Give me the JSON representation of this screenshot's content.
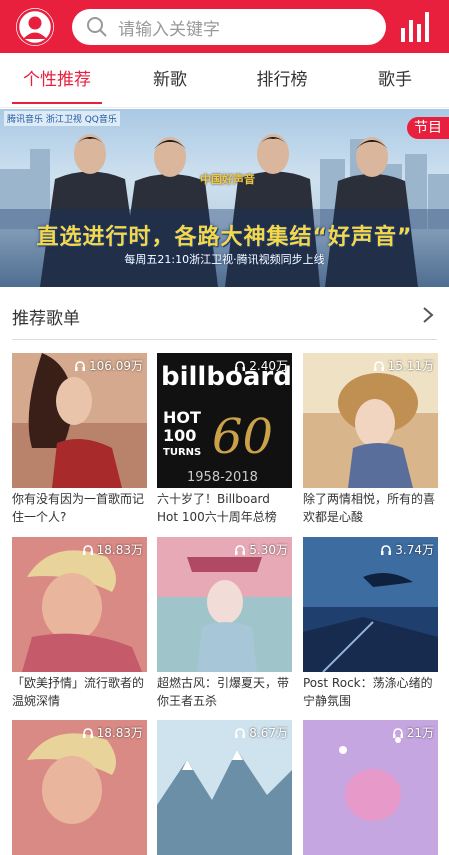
{
  "header": {
    "search_placeholder": "请输入关键字",
    "accent": "#e8203e"
  },
  "tabs": [
    {
      "label": "个性推荐",
      "active": true
    },
    {
      "label": "新歌",
      "active": false
    },
    {
      "label": "排行榜",
      "active": false
    },
    {
      "label": "歌手",
      "active": false
    }
  ],
  "banner": {
    "tag": "节目",
    "logos": "腾讯音乐 浙江卫视 QQ音乐",
    "emblem": "中国好声音",
    "headline": "直选进行时，各路大神集结“好声音”",
    "subline": "每周五21:10浙江卫视·腾讯视频同步上线"
  },
  "section": {
    "title": "推荐歌单"
  },
  "playlists": [
    {
      "plays": "106.09万",
      "title": "你有没有因为一首歌而记住一个人?",
      "icon": "headphones-icon"
    },
    {
      "plays": "2.40万",
      "title": "六十岁了！Billboard Hot 100六十周年总榜",
      "icon": "headphones-icon",
      "cover_text": "billboard HOT 100 TURNS 60 1958-2018"
    },
    {
      "plays": "15.11万",
      "title": "除了两情相悦，所有的喜欢都是心酸",
      "icon": "headphones-icon"
    },
    {
      "plays": "18.83万",
      "title": "「欧美抒情」流行歌者的温婉深情",
      "icon": "headphones-icon"
    },
    {
      "plays": "5.30万",
      "title": "超燃古风：引爆夏天，带你王者五杀",
      "icon": "headphones-icon"
    },
    {
      "plays": "3.74万",
      "title": "Post Rock：荡涤心绪的宁静氛围",
      "icon": "headphones-icon"
    },
    {
      "plays": "18.83万",
      "title": "",
      "icon": "headphones-icon"
    },
    {
      "plays": "8.67万",
      "title": "",
      "icon": "headphones-icon"
    },
    {
      "plays": "21万",
      "title": "",
      "icon": "headphones-icon"
    }
  ]
}
